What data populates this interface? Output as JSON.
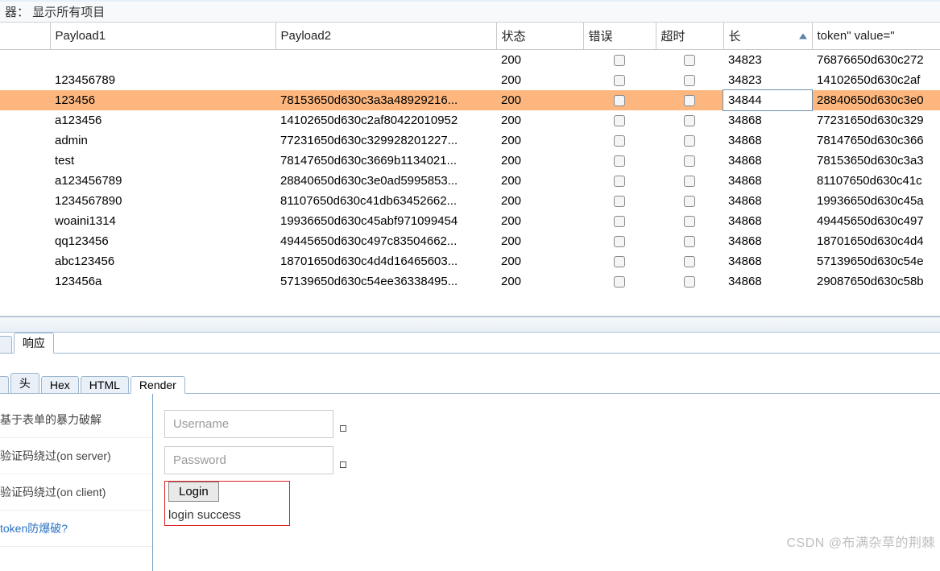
{
  "filter_label": "器：",
  "filter_value": "显示所有项目",
  "columns": {
    "dummy": "",
    "payload1": "Payload1",
    "payload2": "Payload2",
    "status": "状态",
    "error": "错误",
    "timeout": "超时",
    "length": "长",
    "token": "token\" value=\""
  },
  "rows": [
    {
      "p1": "",
      "p2": "",
      "status": "200",
      "len": "34823",
      "tok": "76876650d630c272",
      "sel": false
    },
    {
      "p1": "123456789",
      "p2": "",
      "status": "200",
      "len": "34823",
      "tok": "14102650d630c2af",
      "sel": false
    },
    {
      "p1": "123456",
      "p2": "78153650d630c3a3a48929216...",
      "status": "200",
      "len": "34844",
      "tok": "28840650d630c3e0",
      "sel": true
    },
    {
      "p1": "a123456",
      "p2": "14102650d630c2af80422010952",
      "status": "200",
      "len": "34868",
      "tok": "77231650d630c329",
      "sel": false
    },
    {
      "p1": "admin",
      "p2": "77231650d630c329928201227...",
      "status": "200",
      "len": "34868",
      "tok": "78147650d630c366",
      "sel": false
    },
    {
      "p1": "test",
      "p2": "78147650d630c3669b1134021...",
      "status": "200",
      "len": "34868",
      "tok": "78153650d630c3a3",
      "sel": false
    },
    {
      "p1": "a123456789",
      "p2": "28840650d630c3e0ad5995853...",
      "status": "200",
      "len": "34868",
      "tok": "81107650d630c41c",
      "sel": false
    },
    {
      "p1": "1234567890",
      "p2": "81107650d630c41db63452662...",
      "status": "200",
      "len": "34868",
      "tok": "19936650d630c45a",
      "sel": false
    },
    {
      "p1": "woaini1314",
      "p2": "19936650d630c45abf971099454",
      "status": "200",
      "len": "34868",
      "tok": "49445650d630c497",
      "sel": false
    },
    {
      "p1": "qq123456",
      "p2": "49445650d630c497c83504662...",
      "status": "200",
      "len": "34868",
      "tok": "18701650d630c4d4",
      "sel": false
    },
    {
      "p1": "abc123456",
      "p2": "18701650d630c4d4d16465603...",
      "status": "200",
      "len": "34868",
      "tok": "57139650d630c54e",
      "sel": false
    },
    {
      "p1": "123456a",
      "p2": "57139650d630c54ee36338495...",
      "status": "200",
      "len": "34868",
      "tok": "29087650d630c58b",
      "sel": false
    }
  ],
  "main_tabs": {
    "resp": "响应"
  },
  "sub_tabs": {
    "hdr": "头",
    "hex": "Hex",
    "html": "HTML",
    "render": "Render"
  },
  "nav": {
    "a": "基于表单的暴力破解",
    "b": "验证码绕过(on server)",
    "c": "验证码绕过(on client)",
    "d": "token防爆破?"
  },
  "form": {
    "user_ph": "Username",
    "pass_ph": "Password",
    "login": "Login",
    "result": "login success"
  },
  "watermark": "CSDN @布满杂草的荆棘"
}
